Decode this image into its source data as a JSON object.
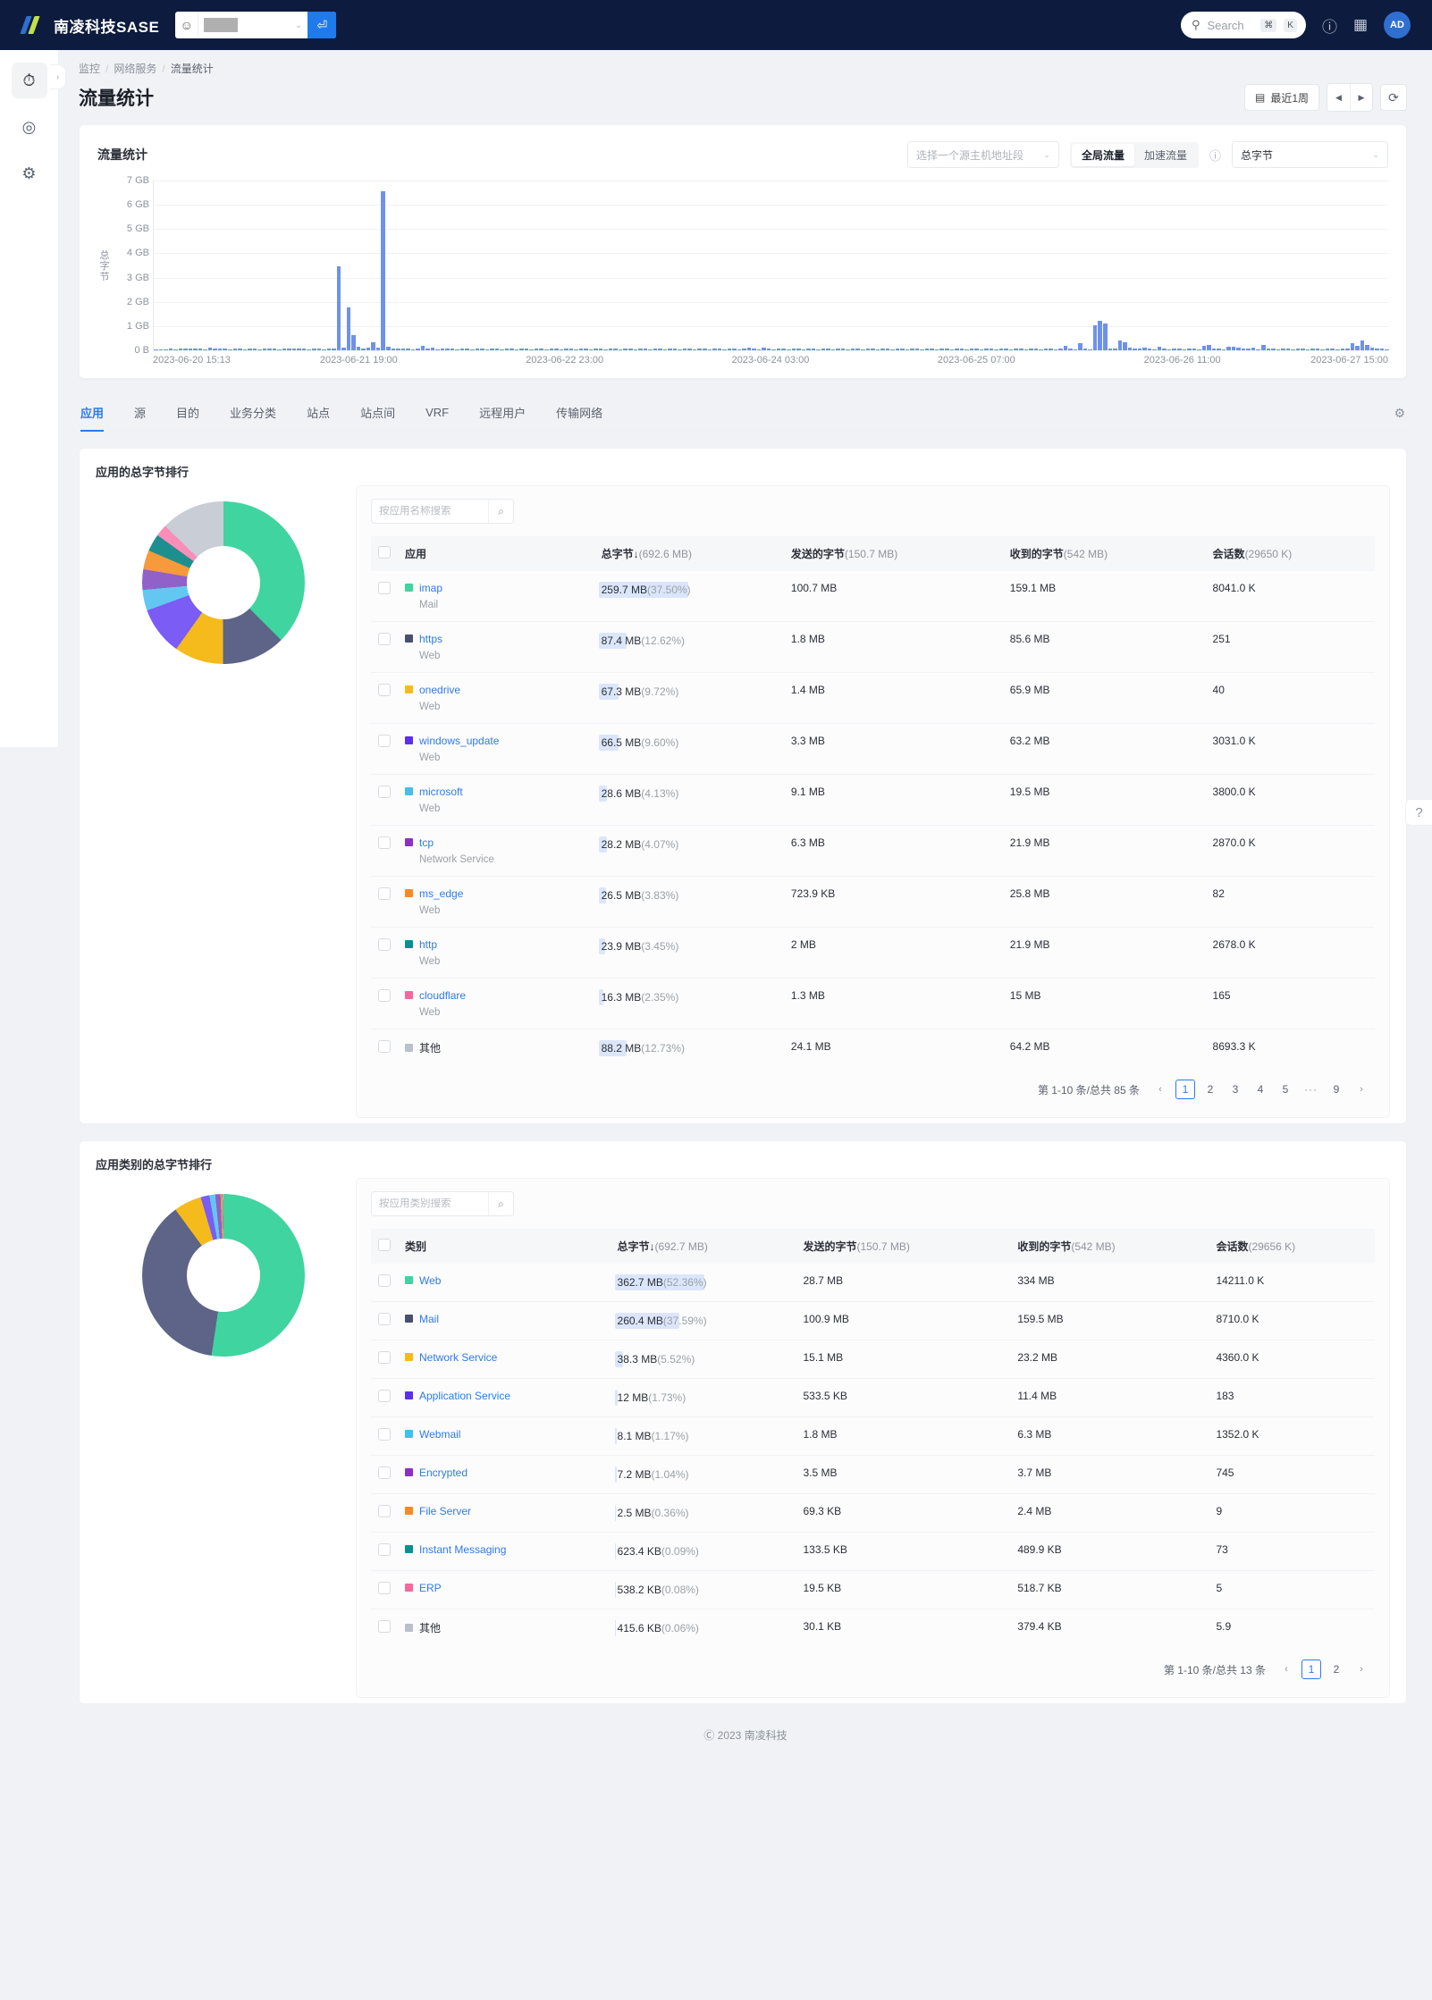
{
  "topbar": {
    "brand": "南凌科技SASE",
    "tenant_caret": "⌄",
    "tenant_apply_icon": "⏎",
    "search_placeholder": "Search",
    "kbd_cmd": "⌘",
    "kbd_key": "K",
    "help_icon": "?",
    "report_icon": "▥",
    "avatar_label": "AD"
  },
  "rail": {
    "items": [
      {
        "name": "monitor",
        "icon": "◔"
      },
      {
        "name": "target",
        "icon": "◎"
      },
      {
        "name": "settings",
        "icon": "⚙"
      }
    ],
    "expand_icon": "›"
  },
  "breadcrumb": {
    "items": [
      "监控",
      "网络服务",
      "流量统计"
    ],
    "separator": "/"
  },
  "header": {
    "title": "流量统计",
    "date_range": "最近1周",
    "calendar_icon": "▤",
    "prev_icon": "◀",
    "next_icon": "▶",
    "refresh_icon": "⟳"
  },
  "chart_card": {
    "title": "流量统计",
    "host_filter_placeholder": "选择一个源主机地址段",
    "segment": {
      "options": [
        "全局流量",
        "加速流量"
      ],
      "selected": "全局流量"
    },
    "info_icon": "ⓘ",
    "metric_select": "总字节",
    "caret": "⌄"
  },
  "chart_data": {
    "type": "bar",
    "title": "流量统计",
    "ylabel": "总字节",
    "xlabel": "",
    "ytick_labels": [
      "7 GB",
      "6 GB",
      "5 GB",
      "4 GB",
      "3 GB",
      "2 GB",
      "1 GB",
      "0 B"
    ],
    "ylim": [
      0,
      7
    ],
    "yunit": "GB",
    "xtick_labels": [
      "2023-06-20 15:13",
      "2023-06-21 19:00",
      "2023-06-22 23:00",
      "2023-06-24 03:00",
      "2023-06-25 07:00",
      "2023-06-26 11:00",
      "2023-06-27 15:00"
    ],
    "grid": true,
    "series_color": "#6f92e8",
    "values": [
      0.02,
      0.05,
      0.04,
      0.06,
      0.05,
      0.08,
      0.07,
      0.06,
      0.09,
      0.07,
      0.05,
      0.12,
      0.08,
      0.06,
      0.07,
      0.05,
      0.06,
      0.08,
      0.05,
      0.07,
      0.06,
      0.05,
      0.08,
      0.06,
      0.07,
      0.05,
      0.06,
      0.09,
      0.07,
      0.06,
      0.08,
      0.05,
      0.07,
      0.06,
      0.05,
      0.08,
      0.06,
      3.45,
      0.1,
      1.78,
      0.62,
      0.14,
      0.08,
      0.1,
      0.32,
      0.12,
      6.55,
      0.15,
      0.07,
      0.09,
      0.06,
      0.08,
      0.05,
      0.07,
      0.18,
      0.06,
      0.12,
      0.05,
      0.08,
      0.06,
      0.07,
      0.05,
      0.06,
      0.08,
      0.05,
      0.07,
      0.06,
      0.05,
      0.08,
      0.06,
      0.05,
      0.07,
      0.06,
      0.05,
      0.08,
      0.06,
      0.05,
      0.07,
      0.06,
      0.05,
      0.08,
      0.06,
      0.05,
      0.07,
      0.06,
      0.05,
      0.08,
      0.06,
      0.05,
      0.07,
      0.06,
      0.05,
      0.08,
      0.06,
      0.05,
      0.07,
      0.06,
      0.05,
      0.08,
      0.06,
      0.05,
      0.07,
      0.06,
      0.05,
      0.08,
      0.06,
      0.05,
      0.07,
      0.06,
      0.05,
      0.08,
      0.06,
      0.05,
      0.07,
      0.06,
      0.05,
      0.08,
      0.06,
      0.05,
      0.07,
      0.1,
      0.06,
      0.05,
      0.12,
      0.06,
      0.05,
      0.08,
      0.06,
      0.05,
      0.07,
      0.06,
      0.05,
      0.08,
      0.06,
      0.05,
      0.07,
      0.06,
      0.05,
      0.08,
      0.06,
      0.05,
      0.07,
      0.06,
      0.05,
      0.08,
      0.06,
      0.05,
      0.07,
      0.06,
      0.05,
      0.08,
      0.06,
      0.05,
      0.07,
      0.06,
      0.05,
      0.08,
      0.06,
      0.05,
      0.07,
      0.06,
      0.05,
      0.08,
      0.06,
      0.05,
      0.07,
      0.06,
      0.05,
      0.08,
      0.06,
      0.05,
      0.07,
      0.06,
      0.05,
      0.08,
      0.06,
      0.05,
      0.07,
      0.06,
      0.05,
      0.08,
      0.06,
      0.05,
      0.07,
      0.18,
      0.06,
      0.05,
      0.3,
      0.08,
      0.05,
      1.05,
      1.22,
      1.12,
      0.08,
      0.06,
      0.42,
      0.35,
      0.1,
      0.06,
      0.08,
      0.12,
      0.06,
      0.05,
      0.14,
      0.07,
      0.05,
      0.08,
      0.06,
      0.05,
      0.07,
      0.06,
      0.05,
      0.2,
      0.22,
      0.08,
      0.06,
      0.05,
      0.16,
      0.14,
      0.12,
      0.08,
      0.06,
      0.1,
      0.05,
      0.22,
      0.08,
      0.06,
      0.05,
      0.07,
      0.06,
      0.05,
      0.08,
      0.06,
      0.05,
      0.07,
      0.06,
      0.05,
      0.08,
      0.06,
      0.05,
      0.07,
      0.06,
      0.28,
      0.18,
      0.4,
      0.22,
      0.12,
      0.08,
      0.06,
      0.05
    ]
  },
  "tabs": {
    "items": [
      "应用",
      "源",
      "目的",
      "业务分类",
      "站点",
      "站点间",
      "VRF",
      "远程用户",
      "传输网络"
    ],
    "active": "应用",
    "gear_icon": "⚙"
  },
  "app_panel": {
    "title": "应用的总字节排行",
    "search_placeholder": "按应用名称搜索",
    "search_icon": "⌕",
    "columns": [
      "应用",
      "总字节↓",
      "发送的字节",
      "收到的字节",
      "会话数"
    ],
    "column_totals": [
      "",
      "(692.6 MB)",
      "(150.7 MB)",
      "(542 MB)",
      "(29650 K)"
    ],
    "rows": [
      {
        "color": "#3fd4a0",
        "name": "imap",
        "category": "Mail",
        "total": "259.7 MB",
        "pct": "(37.50%)",
        "bar": 100,
        "sent": "100.7 MB",
        "recv": "159.1 MB",
        "sessions": "8041.0 K"
      },
      {
        "color": "#49506e",
        "name": "https",
        "category": "Web",
        "total": "87.4 MB",
        "pct": "(12.62%)",
        "bar": 34,
        "sent": "1.8 MB",
        "recv": "85.6 MB",
        "sessions": "251"
      },
      {
        "color": "#f5bb1d",
        "name": "onedrive",
        "category": "Web",
        "total": "67.3 MB",
        "pct": "(9.72%)",
        "bar": 26,
        "sent": "1.4 MB",
        "recv": "65.9 MB",
        "sessions": "40"
      },
      {
        "color": "#5b2ef0",
        "name": "windows_update",
        "category": "Web",
        "total": "66.5 MB",
        "pct": "(9.60%)",
        "bar": 26,
        "sent": "3.3 MB",
        "recv": "63.2 MB",
        "sessions": "3031.0 K"
      },
      {
        "color": "#44bdf0",
        "name": "microsoft",
        "category": "Web",
        "total": "28.6 MB",
        "pct": "(4.13%)",
        "bar": 11,
        "sent": "9.1 MB",
        "recv": "19.5 MB",
        "sessions": "3800.0 K"
      },
      {
        "color": "#8e2fc4",
        "name": "tcp",
        "category": "Network Service",
        "total": "28.2 MB",
        "pct": "(4.07%)",
        "bar": 11,
        "sent": "6.3 MB",
        "recv": "21.9 MB",
        "sessions": "2870.0 K"
      },
      {
        "color": "#f98a23",
        "name": "ms_edge",
        "category": "Web",
        "total": "26.5 MB",
        "pct": "(3.83%)",
        "bar": 10,
        "sent": "723.9 KB",
        "recv": "25.8 MB",
        "sessions": "82"
      },
      {
        "color": "#0b9090",
        "name": "http",
        "category": "Web",
        "total": "23.9 MB",
        "pct": "(3.45%)",
        "bar": 9,
        "sent": "2 MB",
        "recv": "21.9 MB",
        "sessions": "2678.0 K"
      },
      {
        "color": "#f8679c",
        "name": "cloudflare",
        "category": "Web",
        "total": "16.3 MB",
        "pct": "(2.35%)",
        "bar": 6,
        "sent": "1.3 MB",
        "recv": "15 MB",
        "sessions": "165"
      },
      {
        "color": "#b9bfcc",
        "name": "其他",
        "category": "",
        "total": "88.2 MB",
        "pct": "(12.73%)",
        "bar": 34,
        "sent": "24.1 MB",
        "recv": "64.2 MB",
        "sessions": "8693.3 K"
      }
    ],
    "pagination": {
      "info": "第 1-10 条/总共 85 条",
      "prev": "‹",
      "next": "›",
      "pages": [
        "1",
        "2",
        "3",
        "4",
        "5"
      ],
      "dots": "···",
      "last": "9",
      "current": "1"
    },
    "donut_segments": [
      {
        "label": "imap",
        "color": "#3fd4a0",
        "pct": 37.5
      },
      {
        "label": "https",
        "color": "#5d6487",
        "pct": 12.62
      },
      {
        "label": "onedrive",
        "color": "#f5bb1d",
        "pct": 9.72
      },
      {
        "label": "windows_update",
        "color": "#7b5cf5",
        "pct": 9.6
      },
      {
        "label": "microsoft",
        "color": "#62c8f2",
        "pct": 4.13
      },
      {
        "label": "tcp",
        "color": "#9160c8",
        "pct": 4.07
      },
      {
        "label": "ms_edge",
        "color": "#f79a3d",
        "pct": 3.83
      },
      {
        "label": "http",
        "color": "#1e8f8f",
        "pct": 3.45
      },
      {
        "label": "cloudflare",
        "color": "#f98fb8",
        "pct": 2.35
      },
      {
        "label": "其他",
        "color": "#c9cdd6",
        "pct": 12.73
      }
    ]
  },
  "category_panel": {
    "title": "应用类别的总字节排行",
    "search_placeholder": "按应用类别搜索",
    "search_icon": "⌕",
    "columns": [
      "类别",
      "总字节↓",
      "发送的字节",
      "收到的字节",
      "会话数"
    ],
    "column_totals": [
      "",
      "(692.7 MB)",
      "(150.7 MB)",
      "(542 MB)",
      "(29656 K)"
    ],
    "rows": [
      {
        "color": "#3fd4a0",
        "name": "Web",
        "total": "362.7 MB",
        "pct": "(52.36%)",
        "bar": 100,
        "sent": "28.7 MB",
        "recv": "334 MB",
        "sessions": "14211.0 K"
      },
      {
        "color": "#49506e",
        "name": "Mail",
        "total": "260.4 MB",
        "pct": "(37.59%)",
        "bar": 72,
        "sent": "100.9 MB",
        "recv": "159.5 MB",
        "sessions": "8710.0 K"
      },
      {
        "color": "#f5bb1d",
        "name": "Network Service",
        "total": "38.3 MB",
        "pct": "(5.52%)",
        "bar": 11,
        "sent": "15.1 MB",
        "recv": "23.2 MB",
        "sessions": "4360.0 K"
      },
      {
        "color": "#5b2ef0",
        "name": "Application Service",
        "total": "12 MB",
        "pct": "(1.73%)",
        "bar": 4,
        "sent": "533.5 KB",
        "recv": "11.4 MB",
        "sessions": "183"
      },
      {
        "color": "#44bdf0",
        "name": "Webmail",
        "total": "8.1 MB",
        "pct": "(1.17%)",
        "bar": 3,
        "sent": "1.8 MB",
        "recv": "6.3 MB",
        "sessions": "1352.0 K"
      },
      {
        "color": "#8e2fc4",
        "name": "Encrypted",
        "total": "7.2 MB",
        "pct": "(1.04%)",
        "bar": 3,
        "sent": "3.5 MB",
        "recv": "3.7 MB",
        "sessions": "745"
      },
      {
        "color": "#f98a23",
        "name": "File Server",
        "total": "2.5 MB",
        "pct": "(0.36%)",
        "bar": 2,
        "sent": "69.3 KB",
        "recv": "2.4 MB",
        "sessions": "9"
      },
      {
        "color": "#0b9090",
        "name": "Instant Messaging",
        "total": "623.4 KB",
        "pct": "(0.09%)",
        "bar": 2,
        "sent": "133.5 KB",
        "recv": "489.9 KB",
        "sessions": "73"
      },
      {
        "color": "#f8679c",
        "name": "ERP",
        "total": "538.2 KB",
        "pct": "(0.08%)",
        "bar": 2,
        "sent": "19.5 KB",
        "recv": "518.7 KB",
        "sessions": "5"
      },
      {
        "color": "#b9bfcc",
        "name": "其他",
        "total": "415.6 KB",
        "pct": "(0.06%)",
        "bar": 2,
        "sent": "30.1 KB",
        "recv": "379.4 KB",
        "sessions": "5.9"
      }
    ],
    "pagination": {
      "info": "第 1-10 条/总共 13 条",
      "prev": "‹",
      "next": "›",
      "pages": [
        "1",
        "2"
      ],
      "current": "1"
    },
    "donut_segments": [
      {
        "label": "Web",
        "color": "#3fd4a0",
        "pct": 52.36
      },
      {
        "label": "Mail",
        "color": "#5d6487",
        "pct": 37.59
      },
      {
        "label": "Network Service",
        "color": "#f5bb1d",
        "pct": 5.52
      },
      {
        "label": "Application Service",
        "color": "#7b5cf5",
        "pct": 1.73
      },
      {
        "label": "Webmail",
        "color": "#62c8f2",
        "pct": 1.17
      },
      {
        "label": "Encrypted",
        "color": "#9160c8",
        "pct": 1.04
      },
      {
        "label": "File Server",
        "color": "#f79a3d",
        "pct": 0.36
      },
      {
        "label": "Instant Messaging",
        "color": "#1e8f8f",
        "pct": 0.09
      },
      {
        "label": "ERP",
        "color": "#f98fb8",
        "pct": 0.08
      },
      {
        "label": "其他",
        "color": "#c9cdd6",
        "pct": 0.06
      }
    ]
  },
  "help_fab_icon": "?",
  "footer": {
    "text": "Ⓒ 2023 南凌科技"
  }
}
